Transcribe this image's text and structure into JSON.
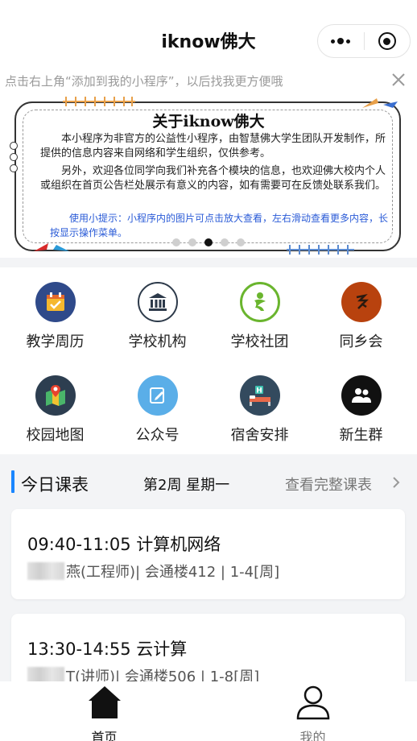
{
  "header": {
    "title": "iknow佛大"
  },
  "capsule": {
    "more_icon": "more-dots-icon",
    "close_icon": "target-icon"
  },
  "tip": {
    "text": "点击右上角“添加到我的小程序”，以后找我更方便哦"
  },
  "notice": {
    "title": "关于iknow佛大",
    "paragraph1": "本小程序为非官方的公益性小程序，由智慧佛大学生团队开发制作，所提供的信息内容来自网络和学生组织，仅供参考。",
    "paragraph2": "另外，欢迎各位同学向我们补充各个模块的信息，也欢迎佛大校内个人或组织在首页公告栏处展示有意义的内容，如有需要可在反馈处联系我们。",
    "hint": "使用小提示：小程序内的图片可点击放大查看，左右滑动查看更多内容，长按显示操作菜单。",
    "slide_count": 5,
    "active_slide": 3
  },
  "grid": [
    {
      "label": "教学周历",
      "icon": "calendar-icon",
      "color": "#2f4a8a"
    },
    {
      "label": "学校机构",
      "icon": "institution-icon",
      "color": "#ffffff"
    },
    {
      "label": "学校社团",
      "icon": "club-icon",
      "color": "#ffffff"
    },
    {
      "label": "同乡会",
      "icon": "hometown-icon",
      "color": "#b8420e"
    },
    {
      "label": "校园地图",
      "icon": "map-icon",
      "color": "#2d3e50"
    },
    {
      "label": "公众号",
      "icon": "edit-icon",
      "color": "#5aaee8"
    },
    {
      "label": "宿舍安排",
      "icon": "dorm-icon",
      "color": "#334a5e"
    },
    {
      "label": "新生群",
      "icon": "group-icon",
      "color": "#111111"
    }
  ],
  "schedule": {
    "title": "今日课表",
    "week": "第2周 星期一",
    "link": "查看完整课表",
    "accent": "#1a86ff",
    "courses": [
      {
        "time_name": "09:40-11:05 计算机网络",
        "teacher_suffix": "燕(工程师)",
        "rest": "| 会通楼412 | 1-4[周]"
      },
      {
        "time_name": "13:30-14:55 云计算",
        "teacher_suffix": "T(讲师)",
        "rest": "| 会通楼506 | 1-8[周]"
      }
    ]
  },
  "tabbar": [
    {
      "label": "首页",
      "icon": "home-icon",
      "active": true
    },
    {
      "label": "我的",
      "icon": "user-icon",
      "active": false
    }
  ]
}
